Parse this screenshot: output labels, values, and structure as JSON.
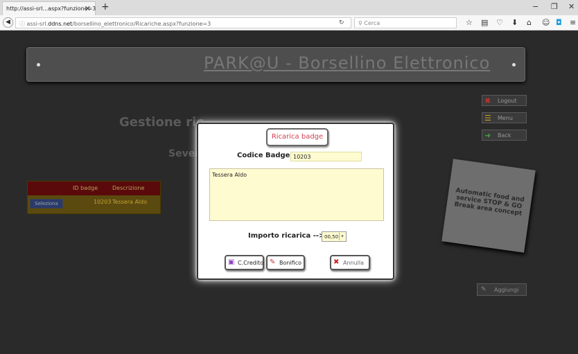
{
  "browser": {
    "tab_title": "http://assi-srl...aspx?funzione=3",
    "tab_close": "✕",
    "new_tab": "+",
    "url_prefix": "assi-srl.",
    "url_domain": "ddns.net",
    "url_path": "/borsellino_elettronico/Ricariche.aspx?funzione=3",
    "search_placeholder": "Cerca",
    "search_icon": "search-icon"
  },
  "header": {
    "title": "PARK@U - Borsellino Elettronico"
  },
  "right_buttons": {
    "logout": "Logout",
    "menu": "Menu",
    "back": "Back",
    "aggiungi": "Aggiungi"
  },
  "page": {
    "heading": "Gestione ric",
    "subheading": "Sever"
  },
  "table": {
    "headers": [
      "ID badge",
      "Descrizione"
    ],
    "rows": [
      {
        "select": "Seleziona",
        "id": "10203",
        "descrizione": "Tessera Aldo"
      }
    ]
  },
  "sticker": {
    "text": "Automatic food and service STOP & GO Break area concept"
  },
  "dialog": {
    "title": "Ricarica badge",
    "badge_label": "Codice Badge -->",
    "badge_value": "10203",
    "description": "Tessera Aldo",
    "importo_label": "Importo ricarica -->",
    "importo_value": "00,50",
    "btn_credito": "C.Credito",
    "btn_bonifico": "Bonifico",
    "btn_annulla": "Annulla"
  },
  "colors": {
    "dialog_title": "#d04050",
    "input_bg": "#fffbd0",
    "table_header": "#5a0a0a"
  }
}
